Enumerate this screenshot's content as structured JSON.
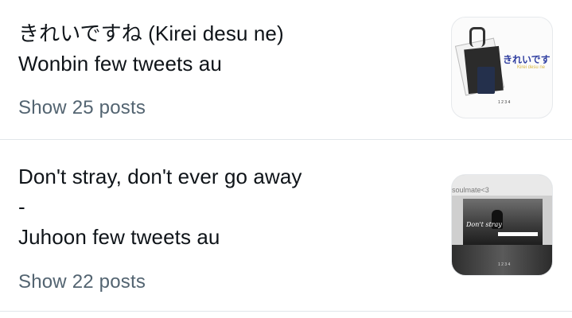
{
  "lists": [
    {
      "title_lines": [
        "きれいですね (Kirei desu ne)",
        "Wonbin few tweets au"
      ],
      "show_posts": "Show 25 posts",
      "thumbnail": {
        "heading": "きれいです",
        "subtitle": "Kirei desu ne",
        "number": "1 2 3 4"
      }
    },
    {
      "title_lines": [
        "Don't stray, don't ever go away",
        "-",
        "Juhoon few tweets au"
      ],
      "show_posts": "Show 22 posts",
      "thumbnail": {
        "label": "soulmate<3",
        "heading": "Don't stray",
        "number": "1 2 3 4"
      }
    }
  ],
  "colors": {
    "text": "#0f1419",
    "secondary": "#536471",
    "divider": "#e1e6ea"
  }
}
